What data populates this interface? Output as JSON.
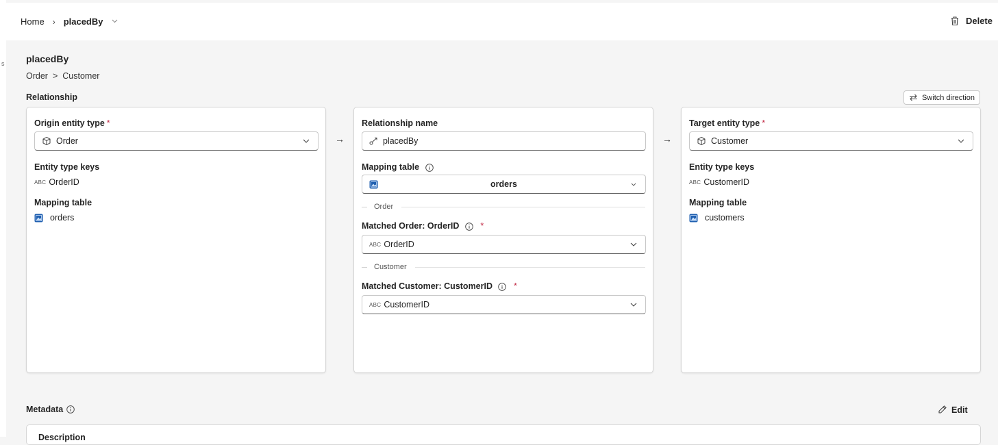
{
  "breadcrumb": {
    "home": "Home",
    "separator": "›",
    "current": "placedBy"
  },
  "toolbar": {
    "delete_label": "Delete"
  },
  "page": {
    "title": "placedBy",
    "path_from": "Order",
    "path_sep": ">",
    "path_to": "Customer",
    "relationship_label": "Relationship",
    "switch_label": "Switch direction"
  },
  "origin": {
    "label": "Origin entity type",
    "required": "*",
    "value": "Order",
    "keys_label": "Entity type keys",
    "key_type": "ABC",
    "key_value": "OrderID",
    "mapping_label": "Mapping table",
    "mapping_value": "orders"
  },
  "middle": {
    "name_label": "Relationship name",
    "name_value": "placedBy",
    "mapping_label": "Mapping table",
    "mapping_value": "orders",
    "section_origin": "Order",
    "matched_origin_label": "Matched Order: OrderID",
    "matched_origin_type": "ABC",
    "matched_origin_value": "OrderID",
    "section_target": "Customer",
    "matched_target_label": "Matched Customer: CustomerID",
    "matched_target_type": "ABC",
    "matched_target_value": "CustomerID",
    "required": "*"
  },
  "target": {
    "label": "Target entity type",
    "required": "*",
    "value": "Customer",
    "keys_label": "Entity type keys",
    "key_type": "ABC",
    "key_value": "CustomerID",
    "mapping_label": "Mapping table",
    "mapping_value": "customers"
  },
  "arrow_glyph": "→",
  "metadata": {
    "label": "Metadata",
    "edit_label": "Edit",
    "description_peek": "Description"
  },
  "colors": {
    "required": "#c4314b",
    "table_icon": "#1f5fb0",
    "background": "#f5f5f5"
  }
}
